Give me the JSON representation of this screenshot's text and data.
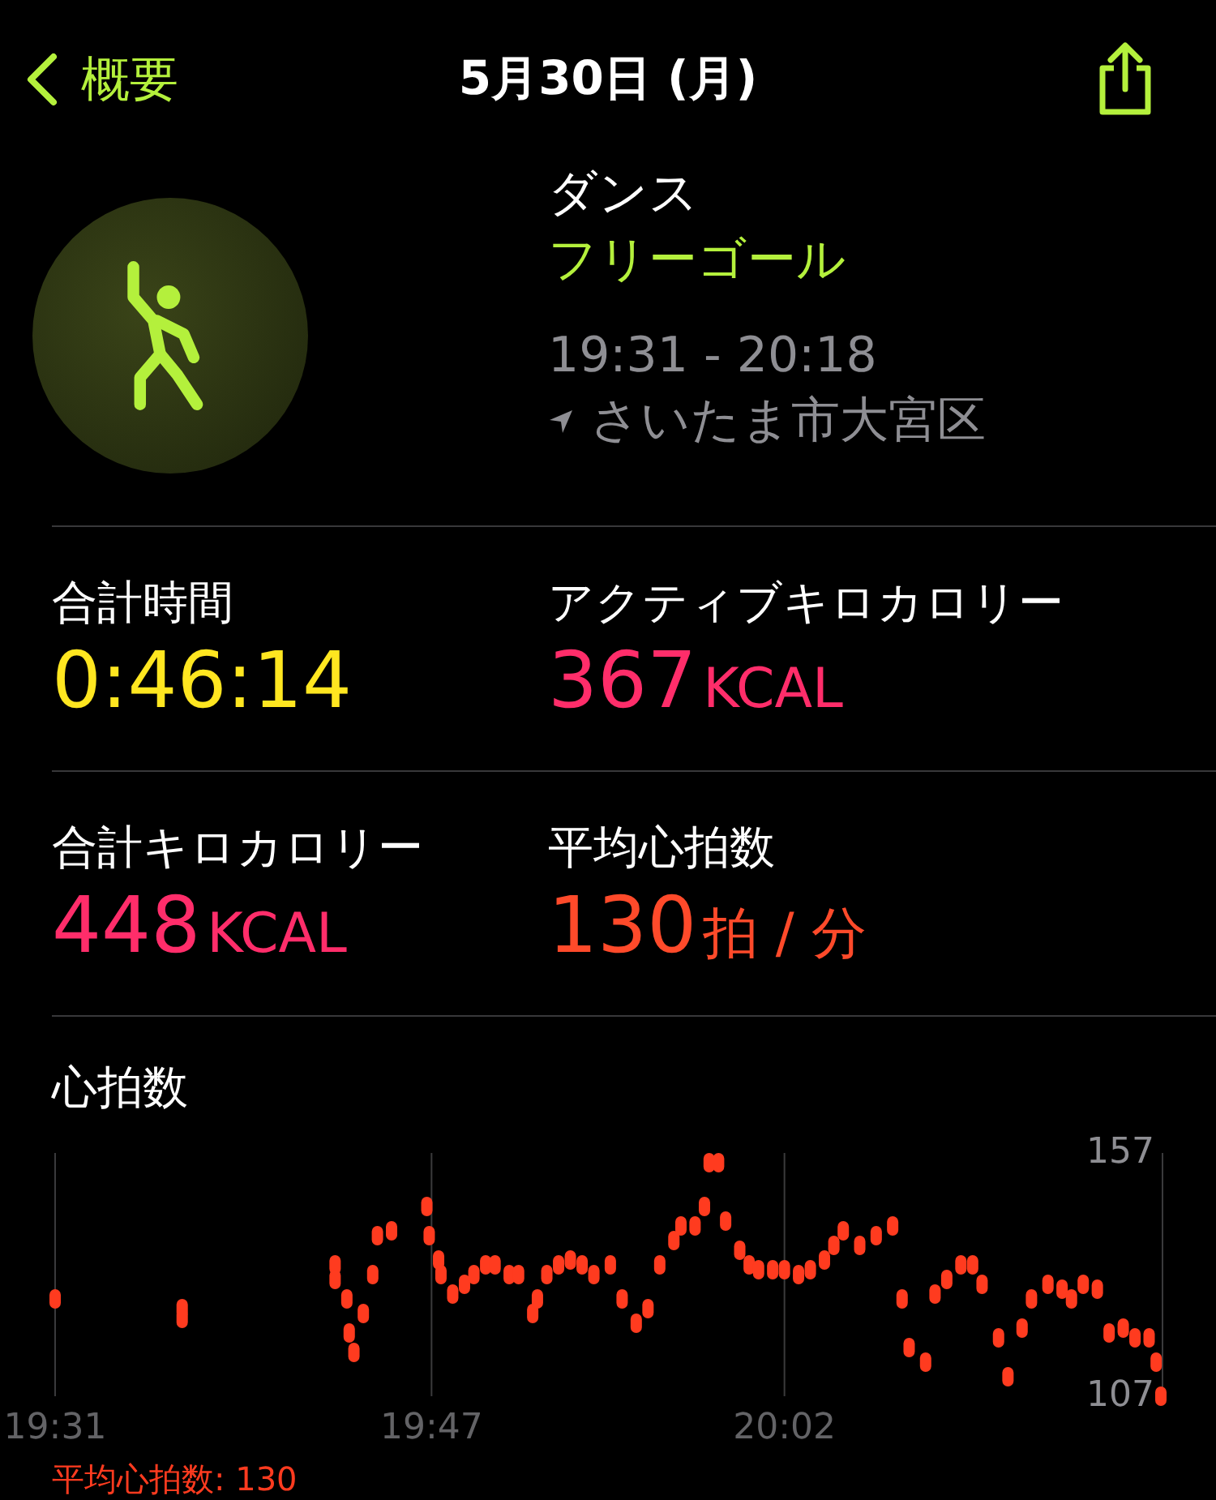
{
  "nav": {
    "back": "概要",
    "title": "5月30日 (月)"
  },
  "workout": {
    "type": "ダンス",
    "goal": "フリーゴール",
    "time": "19:31 - 20:18",
    "location": "さいたま市大宮区"
  },
  "metrics": [
    {
      "label": "合計時間",
      "value": "0:46:14",
      "color": "#ffe620"
    },
    {
      "label": "アクティブキロカロリー",
      "value": "367",
      "unit": "KCAL",
      "color": "#ff2d6a"
    },
    {
      "label": "合計キロカロリー",
      "value": "448",
      "unit": "KCAL",
      "color": "#ff2d6a"
    },
    {
      "label": "平均心拍数",
      "value": "130",
      "unit": "拍 / 分",
      "color": "#ff4a2a"
    }
  ],
  "heart_rate": {
    "title": "心拍数",
    "average": "平均心拍数: 130",
    "chart_data": {
      "type": "scatter",
      "xlim": [
        1171,
        1218
      ],
      "ylim": [
        107,
        157
      ],
      "xticks": [
        {
          "value": 1171,
          "label": "19:31"
        },
        {
          "value": 1187,
          "label": "19:47"
        },
        {
          "value": 1202,
          "label": "20:02"
        }
      ],
      "yticks": [
        107,
        157
      ],
      "series": [
        {
          "color": "#ff3b1f",
          "x": [
            1171,
            1176.4,
            1176.4,
            1182.9,
            1182.9,
            1183.4,
            1183.5,
            1183.7,
            1184.1,
            1184.5,
            1184.7,
            1185.3,
            1186.8,
            1186.9,
            1187.3,
            1187.4,
            1187.9,
            1188.4,
            1188.8,
            1189.3,
            1189.7,
            1190.3,
            1190.7,
            1191.3,
            1191.5,
            1191.9,
            1192.4,
            1192.9,
            1193.4,
            1193.9,
            1194.6,
            1195.1,
            1195.7,
            1196.2,
            1196.7,
            1197.3,
            1197.6,
            1198.2,
            1198.6,
            1198.8,
            1199.2,
            1199.5,
            1200.1,
            1200.5,
            1200.9,
            1201.5,
            1202,
            1202.6,
            1203.1,
            1203.7,
            1204.1,
            1204.5,
            1205.2,
            1205.9,
            1206.6,
            1207,
            1207.3,
            1208,
            1208.4,
            1208.9,
            1209.5,
            1210,
            1210.4,
            1211.1,
            1211.5,
            1212.1,
            1212.5,
            1213.2,
            1213.8,
            1214.2,
            1214.7,
            1215.3,
            1215.8,
            1216.4,
            1216.9,
            1217.5,
            1217.8,
            1218
          ],
          "values": [
            127,
            125,
            123,
            134,
            131,
            127,
            120,
            116,
            124,
            132,
            140,
            141,
            146,
            140,
            135,
            132,
            128,
            130,
            132,
            134,
            134,
            132,
            132,
            124,
            127,
            132,
            134,
            135,
            134,
            132,
            134,
            127,
            122,
            125,
            134,
            139,
            142,
            142,
            146,
            155,
            155,
            143,
            137,
            134,
            133,
            133,
            133,
            132,
            133,
            135,
            138,
            141,
            138,
            140,
            142,
            127,
            117,
            114,
            128,
            131,
            134,
            134,
            130,
            119,
            111,
            121,
            127,
            130,
            129,
            127,
            130,
            129,
            120,
            121,
            119,
            119,
            114,
            107
          ]
        }
      ]
    }
  }
}
